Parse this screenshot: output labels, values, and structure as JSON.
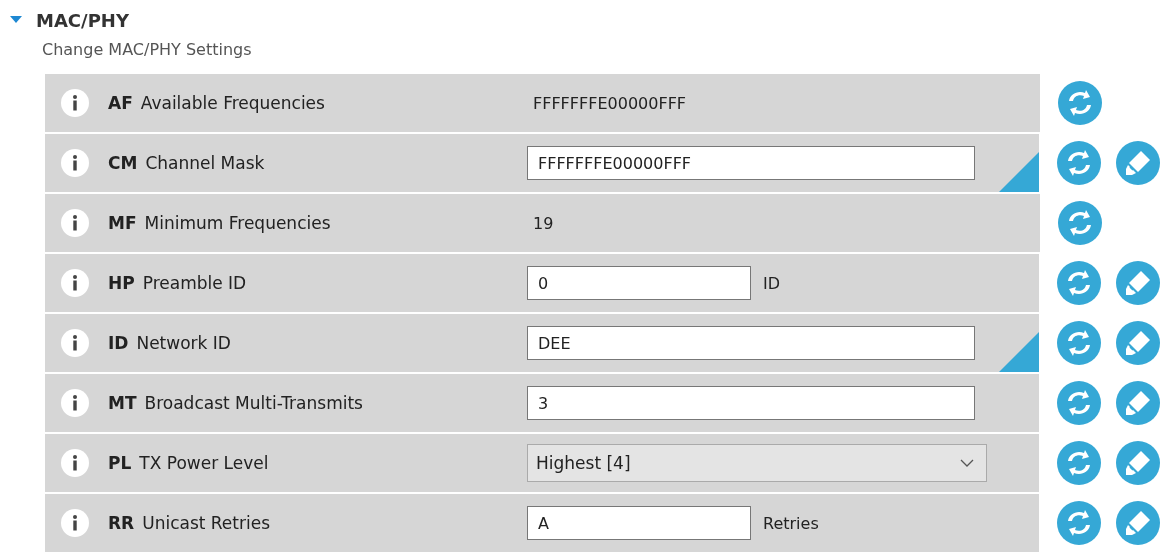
{
  "section": {
    "title": "MAC/PHY",
    "expanded": true,
    "subtitle": "Change MAC/PHY Settings"
  },
  "settings": [
    {
      "code": "AF",
      "name": "Available Frequencies",
      "kind": "readonly",
      "value": "FFFFFFFE00000FFF",
      "modified": false,
      "writable": false
    },
    {
      "code": "CM",
      "name": "Channel Mask",
      "kind": "text",
      "value": "FFFFFFFE00000FFF",
      "modified": true,
      "writable": true
    },
    {
      "code": "MF",
      "name": "Minimum Frequencies",
      "kind": "readonly",
      "value": "19",
      "modified": false,
      "writable": false
    },
    {
      "code": "HP",
      "name": "Preamble ID",
      "kind": "text",
      "value": "0",
      "unit": "ID",
      "modified": false,
      "writable": true
    },
    {
      "code": "ID",
      "name": "Network ID",
      "kind": "text",
      "value": "DEE",
      "modified": true,
      "writable": true
    },
    {
      "code": "MT",
      "name": "Broadcast Multi-Transmits",
      "kind": "text",
      "value": "3",
      "modified": false,
      "writable": true
    },
    {
      "code": "PL",
      "name": "TX Power Level",
      "kind": "select",
      "value": "Highest [4]",
      "modified": false,
      "writable": true
    },
    {
      "code": "RR",
      "name": "Unicast Retries",
      "kind": "text",
      "value": "A",
      "unit": "Retries",
      "modified": false,
      "writable": true
    }
  ]
}
